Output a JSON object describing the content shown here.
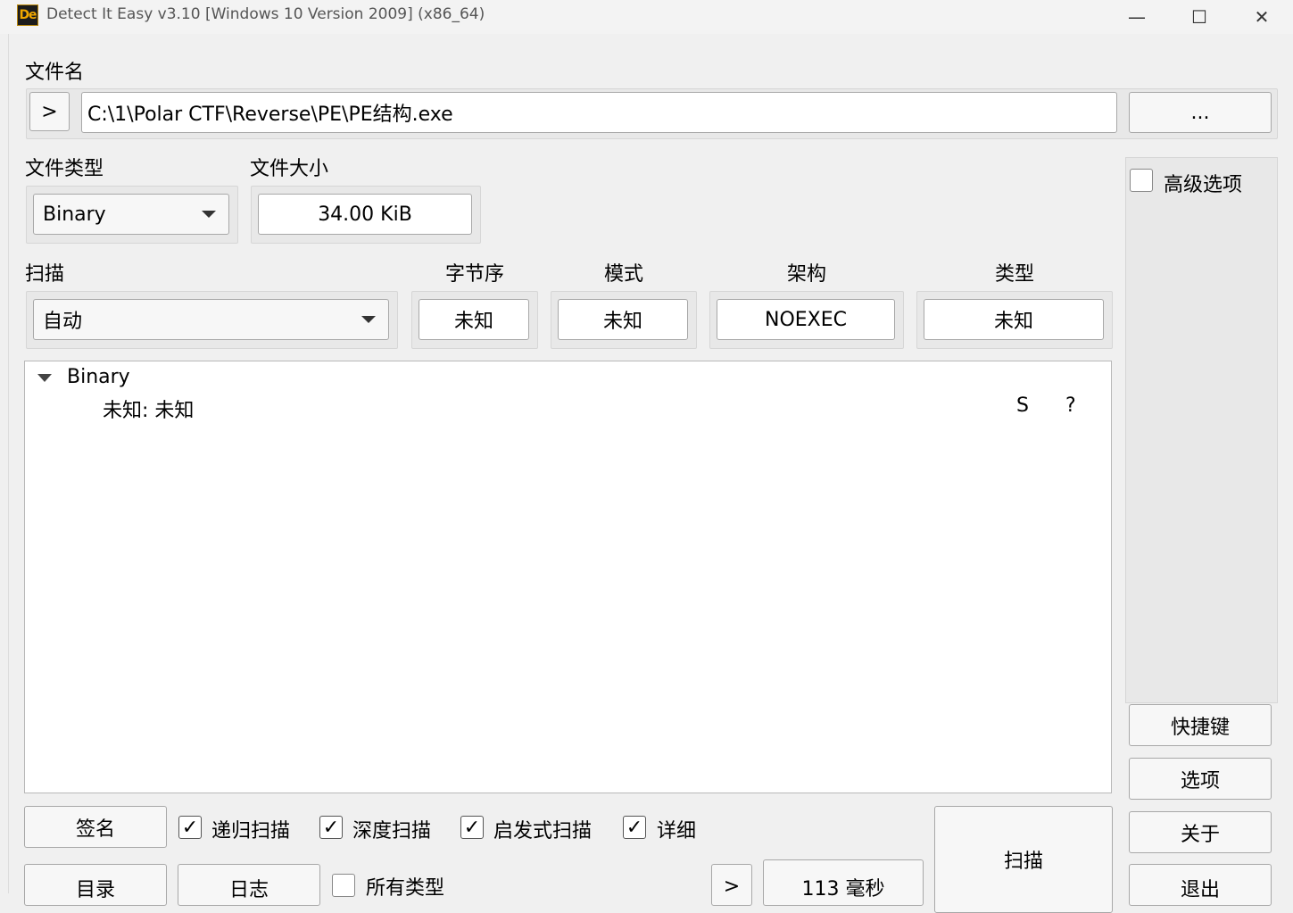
{
  "window": {
    "title": "Detect It Easy v3.10 [Windows 10 Version 2009] (x86_64)",
    "icon_text": "De",
    "minimize_glyph": "—",
    "maximize_glyph": "☐",
    "close_glyph": "✕"
  },
  "file": {
    "label": "文件名",
    "nav_label": ">",
    "path": "C:\\1\\Polar CTF\\Reverse\\PE\\PE结构.exe",
    "browse_label": "..."
  },
  "file_type": {
    "label": "文件类型",
    "value": "Binary"
  },
  "file_size": {
    "label": "文件大小",
    "value": "34.00 KiB"
  },
  "scan": {
    "label": "扫描",
    "value": "自动"
  },
  "endianness": {
    "label": "字节序",
    "value": "未知"
  },
  "mode": {
    "label": "模式",
    "value": "未知"
  },
  "arch": {
    "label": "架构",
    "value": "NOEXEC"
  },
  "type": {
    "label": "类型",
    "value": "未知"
  },
  "advanced": {
    "label": "高级选项",
    "checked": false
  },
  "results": {
    "root": "Binary",
    "items": [
      {
        "text": "未知: 未知",
        "col_s": "S",
        "col_q": "?"
      }
    ]
  },
  "bottom": {
    "signatures_label": "签名",
    "recursive_label": "递归扫描",
    "deep_label": "深度扫描",
    "heuristic_label": "启发式扫描",
    "verbose_label": "详细",
    "check_mark": "✓",
    "directory_label": "目录",
    "log_label": "日志",
    "all_types_label": "所有类型",
    "more_label": ">",
    "time_label": "113 毫秒",
    "scan_label": "扫描"
  },
  "side": {
    "shortcuts_label": "快捷键",
    "options_label": "选项",
    "about_label": "关于",
    "exit_label": "退出"
  }
}
